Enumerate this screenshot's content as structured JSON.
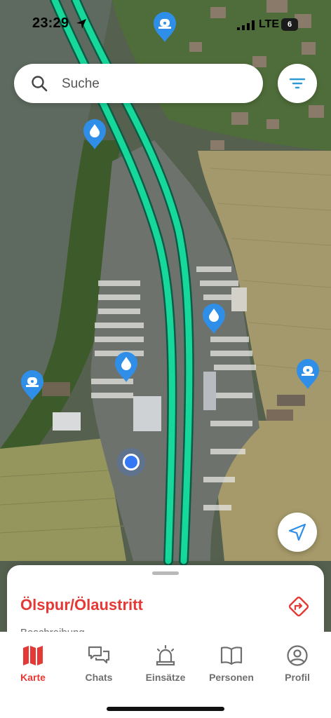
{
  "status_bar": {
    "time": "23:29",
    "network": "LTE",
    "battery": "6"
  },
  "search": {
    "placeholder": "Suche"
  },
  "incident": {
    "title": "Ölspur/Ölaustritt",
    "section_label": "Beschreibung"
  },
  "tabs": [
    {
      "label": "Karte",
      "icon": "map-icon",
      "active": true
    },
    {
      "label": "Chats",
      "icon": "chat-icon",
      "active": false
    },
    {
      "label": "Einsätze",
      "icon": "siren-icon",
      "active": false
    },
    {
      "label": "Personen",
      "icon": "book-icon",
      "active": false
    },
    {
      "label": "Profil",
      "icon": "profile-icon",
      "active": false
    }
  ],
  "colors": {
    "accent": "#e53935",
    "marker": "#2f8fe8",
    "highway": "#16d89a",
    "user_location": "#3478f6"
  },
  "map": {
    "markers": [
      {
        "type": "siren",
        "icon": "siren-marker-icon"
      },
      {
        "type": "oil",
        "icon": "oil-drop-marker-icon"
      },
      {
        "type": "oil",
        "icon": "oil-drop-marker-icon"
      },
      {
        "type": "oil",
        "icon": "oil-drop-marker-icon"
      },
      {
        "type": "siren",
        "icon": "siren-marker-icon"
      },
      {
        "type": "siren",
        "icon": "siren-marker-icon"
      }
    ]
  }
}
